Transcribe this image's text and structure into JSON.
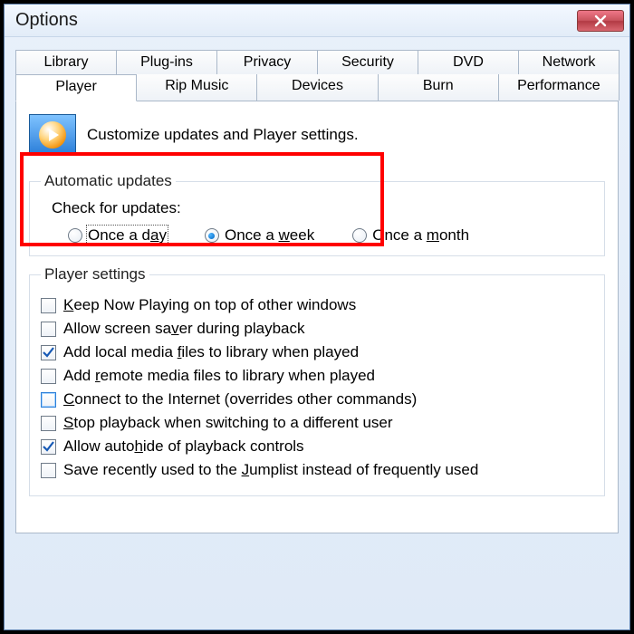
{
  "window": {
    "title": "Options"
  },
  "tabs_row1": [
    {
      "label": "Library"
    },
    {
      "label": "Plug-ins"
    },
    {
      "label": "Privacy"
    },
    {
      "label": "Security"
    },
    {
      "label": "DVD"
    },
    {
      "label": "Network"
    }
  ],
  "tabs_row2": [
    {
      "label": "Player",
      "active": true
    },
    {
      "label": "Rip Music"
    },
    {
      "label": "Devices"
    },
    {
      "label": "Burn"
    },
    {
      "label": "Performance"
    }
  ],
  "intro": "Customize updates and Player settings.",
  "auto_updates": {
    "legend": "Automatic updates",
    "check_label": "Check for updates:",
    "options": {
      "day_pre": "Once a d",
      "day_u": "a",
      "day_post": "y",
      "week_pre": "Once a ",
      "week_u": "w",
      "week_post": "eek",
      "month_pre": "Once a ",
      "month_u": "m",
      "month_post": "onth"
    },
    "selected": "week",
    "focused": "day"
  },
  "player_settings": {
    "legend": "Player settings",
    "items": [
      {
        "checked": false,
        "pre": "",
        "u": "K",
        "post": "eep Now Playing on top of other windows"
      },
      {
        "checked": false,
        "pre": "Allow screen sa",
        "u": "v",
        "post": "er during playback"
      },
      {
        "checked": true,
        "pre": "Add local media ",
        "u": "f",
        "post": "iles to library when played"
      },
      {
        "checked": false,
        "pre": "Add ",
        "u": "r",
        "post": "emote media files to library when played"
      },
      {
        "checked": false,
        "pre": "",
        "u": "C",
        "post": "onnect to the Internet (overrides other commands)",
        "blue": true
      },
      {
        "checked": false,
        "pre": "",
        "u": "S",
        "post": "top playback when switching to a different user"
      },
      {
        "checked": true,
        "pre": "Allow auto",
        "u": "h",
        "post": "ide of playback controls"
      },
      {
        "checked": false,
        "pre": "Save recently used to the ",
        "u": "J",
        "post": "umplist instead of frequently used"
      }
    ]
  }
}
